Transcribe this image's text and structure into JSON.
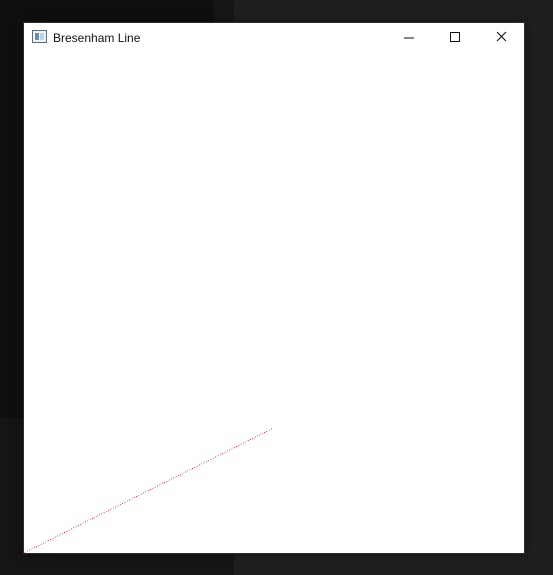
{
  "window": {
    "title": "Bresenham Line",
    "line_color": "#e53935",
    "icons": {
      "app": "app-window-icon",
      "minimize": "minimize-icon",
      "maximize": "maximize-icon",
      "close": "close-icon"
    }
  }
}
